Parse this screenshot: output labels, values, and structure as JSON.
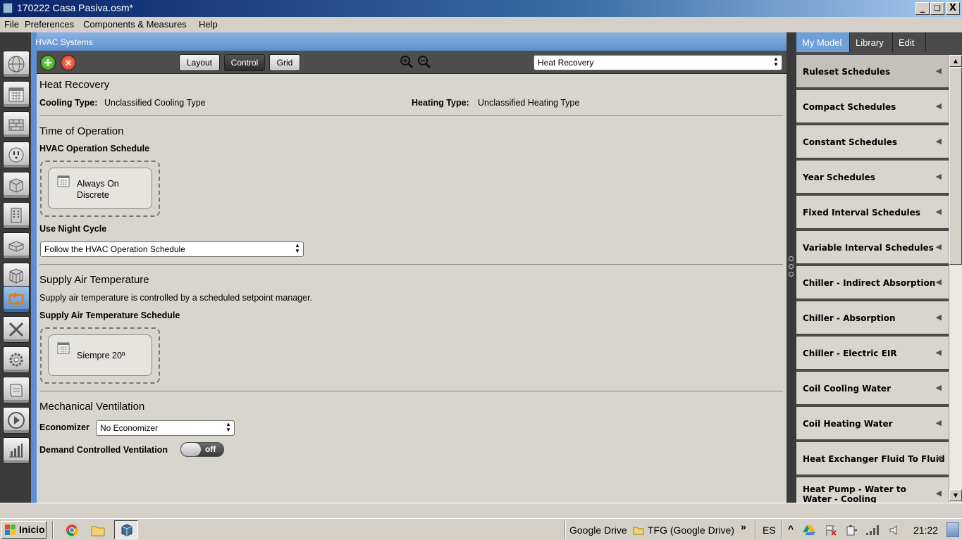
{
  "window": {
    "title": "170222 Casa Pasiva.osm*",
    "minimize": "_",
    "maximize": "❏",
    "close": "X"
  },
  "menubar": [
    "File",
    "Preferences",
    "Components & Measures",
    "Help"
  ],
  "panel": {
    "title": "HVAC Systems"
  },
  "toolbar": {
    "add_icon": "plus-circle-green",
    "remove_icon": "x-circle-red",
    "views": [
      "Layout",
      "Control",
      "Grid"
    ],
    "active_view": "Control",
    "system_selected": "Heat Recovery"
  },
  "content": {
    "system_name": "Heat Recovery",
    "cooling_type_label": "Cooling Type:",
    "cooling_type_value": "Unclassified Cooling Type",
    "heating_type_label": "Heating Type:",
    "heating_type_value": "Unclassified Heating Type",
    "time_of_operation": {
      "heading": "Time of Operation",
      "schedule_label": "HVAC Operation Schedule",
      "schedule_name_line1": "Always On",
      "schedule_name_line2": "Discrete",
      "night_cycle_label": "Use Night Cycle",
      "night_cycle_value": "Follow the HVAC Operation Schedule"
    },
    "supply_air": {
      "heading": "Supply Air Temperature",
      "description": "Supply air temperature is controlled by a scheduled setpoint manager.",
      "schedule_label": "Supply Air Temperature Schedule",
      "schedule_name": "Siempre 20º"
    },
    "mechanical_ventilation": {
      "heading": "Mechanical Ventilation",
      "economizer_label": "Economizer",
      "economizer_value": "No Economizer",
      "dcv_label": "Demand Controlled Ventilation",
      "dcv_state": "off"
    }
  },
  "right_panel": {
    "tabs": [
      "My Model",
      "Library",
      "Edit"
    ],
    "active_tab": "My Model",
    "items": [
      "Ruleset Schedules",
      "Compact Schedules",
      "Constant Schedules",
      "Year Schedules",
      "Fixed Interval Schedules",
      "Variable Interval Schedules",
      "Chiller - Indirect Absorption",
      "Chiller - Absorption",
      "Chiller - Electric EIR",
      "Coil Cooling Water",
      "Coil Heating Water",
      "Heat Exchanger Fluid To Fluid",
      "Heat Pump - Water to Water - Cooling"
    ]
  },
  "taskbar": {
    "start_label": "Inicio",
    "toolbars": [
      "Google Drive",
      "TFG (Google Drive)"
    ],
    "overflow": "»",
    "language": "ES",
    "tray_up": "^",
    "clock": "21:22"
  }
}
